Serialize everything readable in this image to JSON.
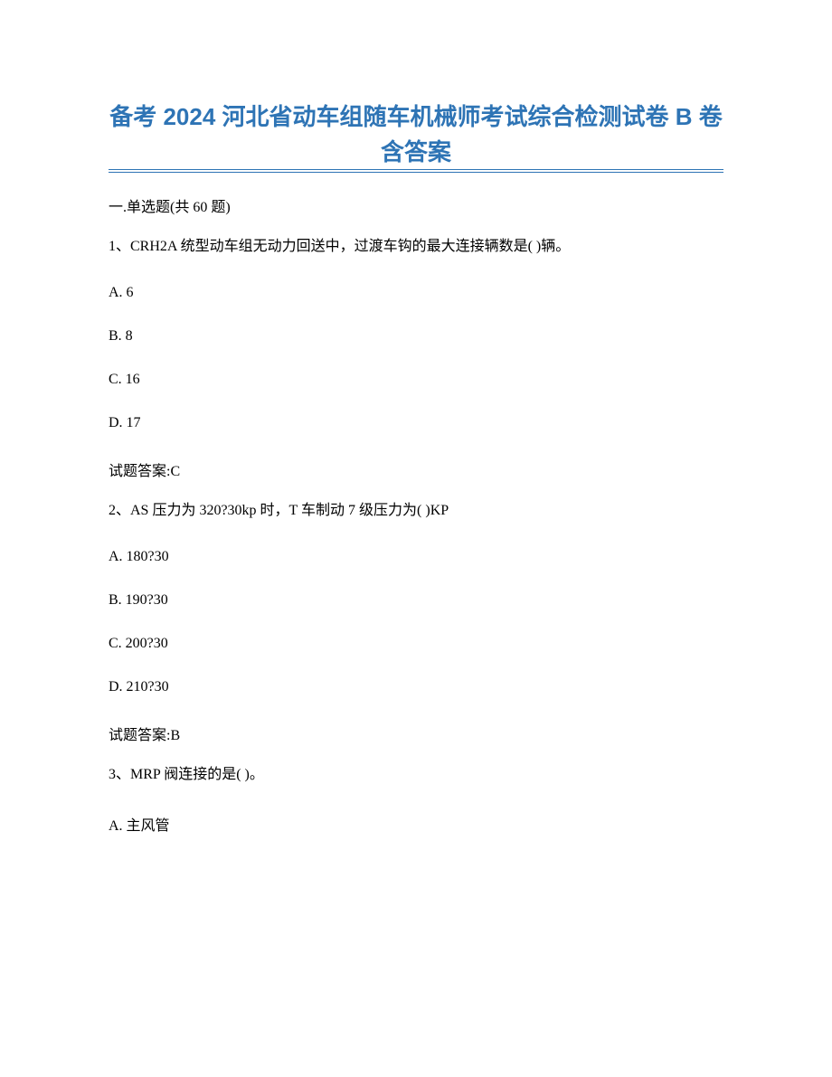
{
  "title_line1": "备考 2024 河北省动车组随车机械师考试综合检测试卷 B 卷",
  "title_line2": "含答案",
  "section_header": "一.单选题(共 60 题)",
  "questions": [
    {
      "stem": "1、CRH2A 统型动车组无动力回送中，过渡车钩的最大连接辆数是(    )辆。",
      "options": [
        "A. 6",
        "B. 8",
        "C. 16",
        "D. 17"
      ],
      "answer": "试题答案:C"
    },
    {
      "stem": "2、AS 压力为 320?30kp 时，T 车制动 7 级压力为(    )KP",
      "options": [
        "A. 180?30",
        "B. 190?30",
        "C. 200?30",
        "D. 210?30"
      ],
      "answer": "试题答案:B"
    },
    {
      "stem": "3、MRP 阀连接的是(    )。",
      "options": [
        "A. 主风管"
      ]
    }
  ]
}
